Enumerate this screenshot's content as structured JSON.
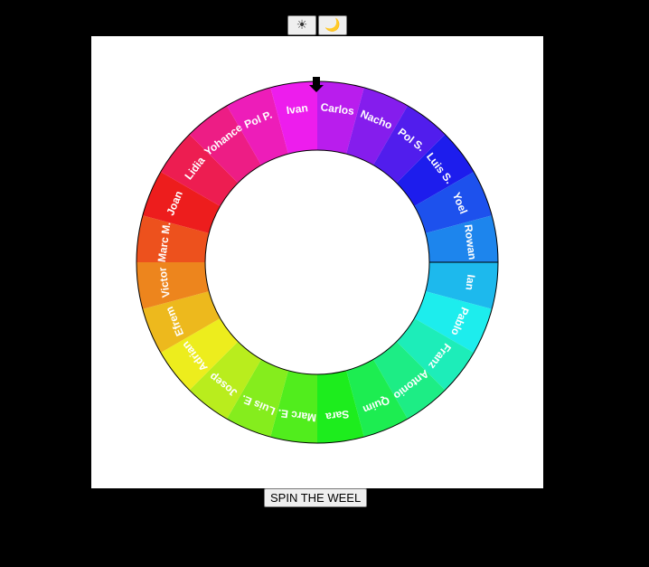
{
  "theme": {
    "light_icon": "☀",
    "dark_icon": "🌙"
  },
  "wheel": {
    "pointer_icon": "arrow-down-icon",
    "names": [
      "Carlos",
      "Nacho",
      "Pol S.",
      "Luis S.",
      "Yoel",
      "Rowan",
      "Ian",
      "Pablo",
      "Franz",
      "Antonio",
      "Quim",
      "Sara",
      "Marc E.",
      "Luis E.",
      "Josep",
      "Adrian",
      "Efrem",
      "Victor",
      "Marc M.",
      "Joan",
      "Lidia",
      "Yohance",
      "Pol P.",
      "Ivan"
    ]
  },
  "spin_button": "SPIN THE WEEL"
}
